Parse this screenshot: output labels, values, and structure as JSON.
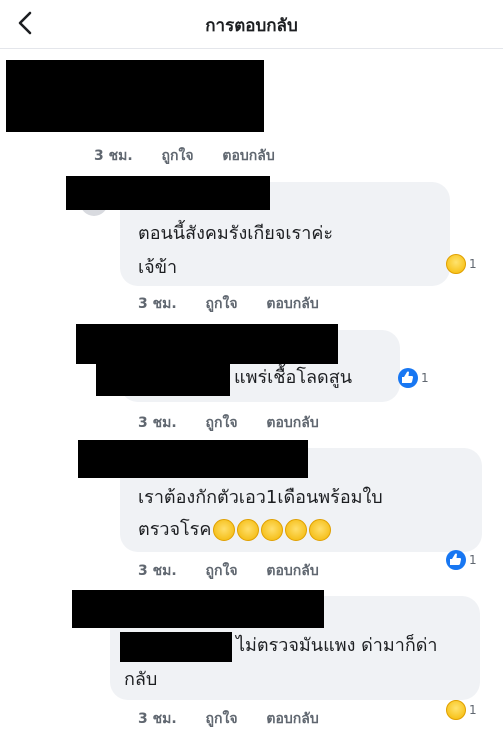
{
  "header": {
    "title": "การตอบกลับ"
  },
  "comments": [
    {
      "time": "3 ชม.",
      "like_label": "ถูกใจ",
      "reply_label": "ตอบกลับ"
    },
    {
      "text_line1": "ตอนนี้สังคมรังเกียจเราค่ะ",
      "text_line2": "เจ้ข้า",
      "reaction_icon": "haha-emoji",
      "reaction_count": "1",
      "time": "3 ชม.",
      "like_label": "ถูกใจ",
      "reply_label": "ตอบกลับ"
    },
    {
      "text_line1": "แพร่เชื้อโลดสูน",
      "reaction_icon": "like-thumb",
      "reaction_count": "1",
      "time": "3 ชม.",
      "like_label": "ถูกใจ",
      "reply_label": "ตอบกลับ"
    },
    {
      "text_line1": "เราต้องกักตัวเอว1เดือนพร้อมใบ",
      "text_line2": "ตรวจโรค",
      "inline_emojis": [
        "sweat-smile-emoji",
        "sweat-smile-emoji",
        "sweat-smile-emoji",
        "downcast-sweat-emoji",
        "downcast-sweat-emoji"
      ],
      "reaction_icon": "like-thumb",
      "reaction_count": "1",
      "time": "3 ชม.",
      "like_label": "ถูกใจ",
      "reply_label": "ตอบกลับ"
    },
    {
      "text_line1": "ไม่ตรวจมันแพง ด่ามาก็ด่า",
      "text_line2": "กลับ",
      "reaction_icon": "haha-emoji",
      "reaction_count": "1",
      "time": "3 ชม.",
      "like_label": "ถูกใจ",
      "reply_label": "ตอบกลับ"
    }
  ],
  "colors": {
    "bubble": "#f0f2f5",
    "meta_text": "#606770",
    "like_blue": "#1877f2",
    "redaction": "#000000"
  }
}
